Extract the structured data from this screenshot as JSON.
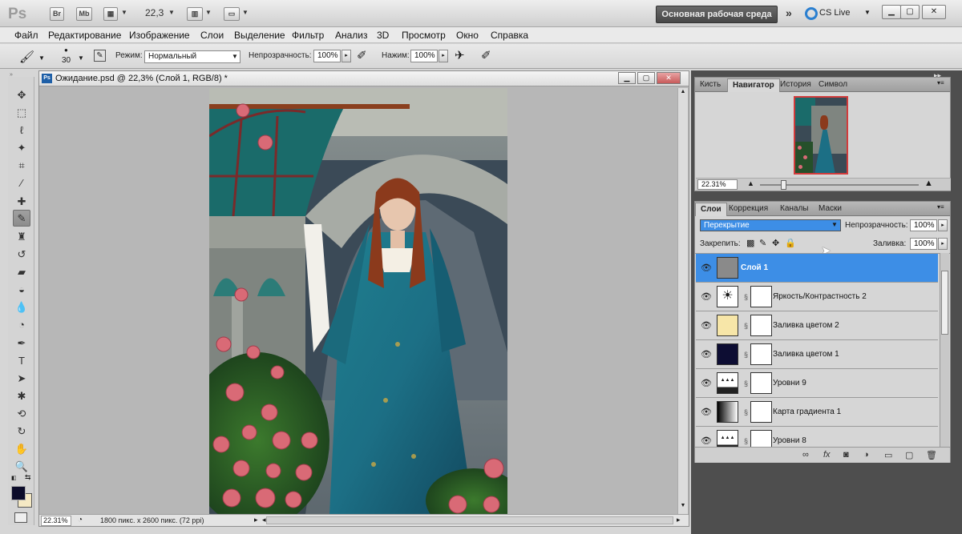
{
  "app": {
    "logo": "Ps",
    "bridge": "Br",
    "minibridge": "Mb",
    "zoom": "22,3",
    "workspace": "Основная рабочая среда",
    "cs_live": "CS Live",
    "win_min": "▁",
    "win_max": "▢",
    "win_close": "✕"
  },
  "menu": [
    "Файл",
    "Редактирование",
    "Изображение",
    "Слои",
    "Выделение",
    "Фильтр",
    "Анализ",
    "3D",
    "Просмотр",
    "Окно",
    "Справка"
  ],
  "options": {
    "brush_size": "30",
    "mode_label": "Режим:",
    "mode_value": "Нормальный",
    "opacity_label": "Непрозрачность:",
    "opacity_value": "100%",
    "flow_label": "Нажим:",
    "flow_value": "100%"
  },
  "document": {
    "title": "Ожидание.psd @ 22,3% (Слой 1, RGB/8) *",
    "zoom": "22.31%",
    "info": "1800 пикс. x 2600 пикс. (72 ppi)"
  },
  "navigator": {
    "tabs": [
      "Кисть",
      "Навигатор",
      "История",
      "Символ"
    ],
    "active_tab": "Навигатор",
    "zoom": "22.31%",
    "zoom_slider": 0.13
  },
  "layers": {
    "tabs": [
      "Слои",
      "Коррекция",
      "Каналы",
      "Маски"
    ],
    "blend_mode": "Перекрытие",
    "opacity_label": "Непрозрачность:",
    "opacity_value": "100%",
    "lock_label": "Закрепить:",
    "fill_label": "Заливка:",
    "fill_value": "100%",
    "items": [
      {
        "name": "Слой 1",
        "selected": true,
        "thumb": "#8a8a8a",
        "mask": false
      },
      {
        "name": "Яркость/Контрастность 2",
        "selected": false,
        "thumb": "adjust",
        "mask": true
      },
      {
        "name": "Заливка цветом 2",
        "selected": false,
        "thumb": "#f7e6a8",
        "mask": true
      },
      {
        "name": "Заливка цветом 1",
        "selected": false,
        "thumb": "#0d0d33",
        "mask": true
      },
      {
        "name": "Уровни 9",
        "selected": false,
        "thumb": "levels",
        "mask": true
      },
      {
        "name": "Карта градиента 1",
        "selected": false,
        "thumb": "gradient",
        "mask": true
      },
      {
        "name": "Уровни 8",
        "selected": false,
        "thumb": "levels",
        "mask": true
      }
    ]
  },
  "colors": {
    "foreground": "#0b0b2a",
    "background": "#f5e9c4",
    "selection": "#3d8ee6"
  }
}
